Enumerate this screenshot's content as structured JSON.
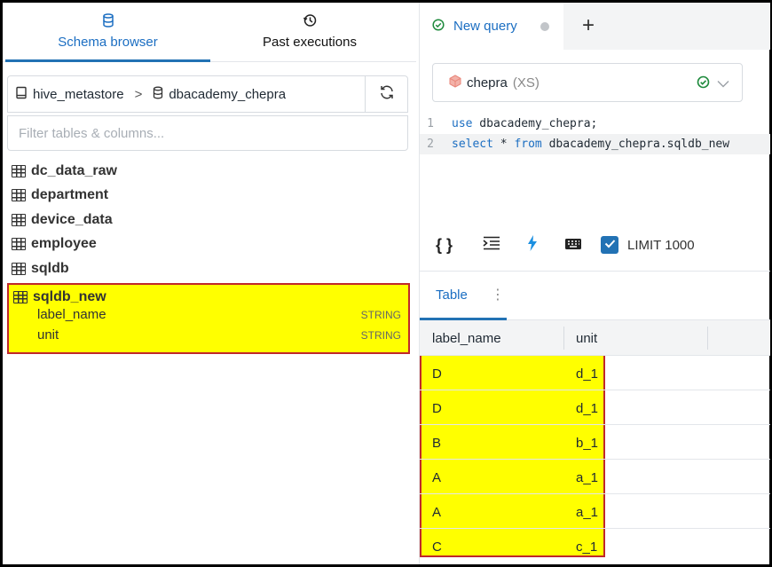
{
  "left_tabs": {
    "schema_label": "Schema browser",
    "past_label": "Past executions"
  },
  "breadcrumb": {
    "catalog": "hive_metastore",
    "separator": ">",
    "schema": "dbacademy_chepra"
  },
  "filter": {
    "placeholder": "Filter tables & columns..."
  },
  "tables": [
    {
      "name": "dc_data_raw"
    },
    {
      "name": "department"
    },
    {
      "name": "device_data"
    },
    {
      "name": "employee"
    },
    {
      "name": "sqldb"
    }
  ],
  "selected_table": {
    "name": "sqldb_new",
    "columns": [
      {
        "name": "label_name",
        "type": "STRING"
      },
      {
        "name": "unit",
        "type": "STRING"
      }
    ]
  },
  "query_tab": {
    "label": "New query",
    "add_label": "+"
  },
  "warehouse": {
    "name": "chepra",
    "size": "(XS)"
  },
  "editor": {
    "lines": [
      {
        "num": "1",
        "kw": "use",
        "rest": " dbacademy_chepra;"
      },
      {
        "num": "2",
        "kw": "select",
        "mid": " * ",
        "kw2": "from",
        "rest": " dbacademy_chepra.sqldb_new"
      }
    ]
  },
  "toolbar": {
    "format_icon": "{ }",
    "limit_label": "LIMIT 1000",
    "limit_checked": true
  },
  "results": {
    "tab_label": "Table",
    "more_label": "⋮",
    "columns": [
      "label_name",
      "unit"
    ],
    "rows": [
      [
        "D",
        "d_1"
      ],
      [
        "D",
        "d_1"
      ],
      [
        "B",
        "b_1"
      ],
      [
        "A",
        "a_1"
      ],
      [
        "A",
        "a_1"
      ],
      [
        "C",
        "c_1"
      ]
    ]
  },
  "colors": {
    "accent": "#2272b4",
    "highlight": "#ffff00",
    "highlight_border": "#c0282a",
    "success": "#1e8a3c"
  }
}
